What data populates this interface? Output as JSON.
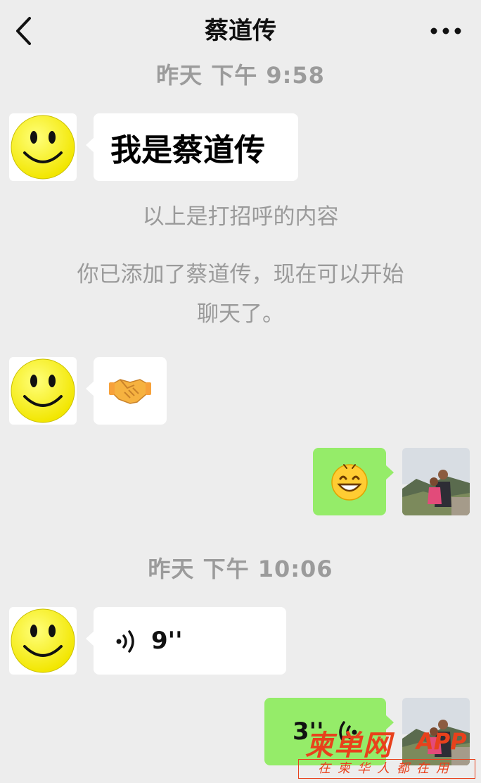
{
  "header": {
    "title": "蔡道传",
    "back_icon": "chevron-left-icon",
    "more_icon": "more-dots-icon"
  },
  "messages": {
    "time_1": "昨天 下午 9:58",
    "greeting_text": "我是蔡道传",
    "system_1": "以上是打招呼的内容",
    "system_2_line1": "你已添加了蔡道传，现在可以开始",
    "system_2_line2": "聊天了。",
    "handshake_icon": "handshake-emoji",
    "grin_icon": "grinning-emoji",
    "time_2": "昨天 下午 10:06",
    "voice_in_duration": "9''",
    "voice_out_duration": "3''"
  },
  "watermark": {
    "brand": "柬单网",
    "app": "APP",
    "slogan": "在柬华人都在用"
  },
  "colors": {
    "background": "#ededed",
    "bubble_in": "#ffffff",
    "bubble_out": "#95ec69",
    "system_text": "#9a9a9a",
    "watermark": "#e8411c"
  }
}
